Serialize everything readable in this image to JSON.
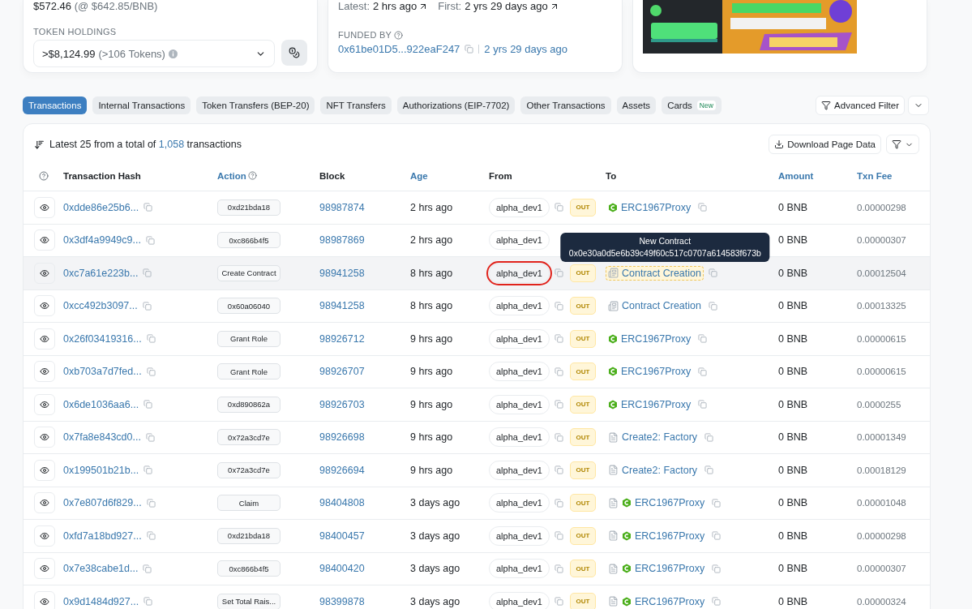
{
  "price_line": {
    "value": "$572.46",
    "rate": "(@ $642.85/BNB)"
  },
  "token_holdings": {
    "label": "TOKEN HOLDINGS",
    "value": ">$8,124.99",
    "count": "(>106 Tokens)"
  },
  "activity": {
    "latest_label": "Latest:",
    "latest": "2 hrs ago",
    "first_label": "First:",
    "first": "2 yrs 29 days ago"
  },
  "funded_by": {
    "label": "FUNDED BY",
    "address": "0x61be01D5...922eaF247",
    "age": "2 yrs 29 days ago"
  },
  "tabs": [
    {
      "label": "Transactions",
      "selected": true
    },
    {
      "label": "Internal Transactions",
      "selected": false
    },
    {
      "label": "Token Transfers (BEP-20)",
      "selected": false
    },
    {
      "label": "NFT Transfers",
      "selected": false
    },
    {
      "label": "Authorizations (EIP-7702)",
      "selected": false
    },
    {
      "label": "Other Transactions",
      "selected": false
    },
    {
      "label": "Assets",
      "selected": false
    },
    {
      "label": "Cards",
      "selected": false,
      "badge": "New"
    }
  ],
  "advanced_filter": "Advanced Filter",
  "summary": {
    "prefix": "Latest 25 from a total of",
    "count": "1,058",
    "suffix": "transactions"
  },
  "download_button": "Download Page Data",
  "table": {
    "columns": [
      {
        "label": "Transaction Hash",
        "sortable": false
      },
      {
        "label": "Action",
        "sortable": true,
        "help": true
      },
      {
        "label": "Block",
        "sortable": false
      },
      {
        "label": "Age",
        "sortable": true
      },
      {
        "label": "From",
        "sortable": false
      },
      {
        "label": "To",
        "sortable": false
      },
      {
        "label": "Amount",
        "sortable": true
      },
      {
        "label": "Txn Fee",
        "sortable": true
      }
    ],
    "rows": [
      {
        "hash": "0xdde86e25b6...",
        "action": "0xd21bda18",
        "block": "98987874",
        "age": "2 hrs ago",
        "from": "alpha_dev1",
        "direction": "OUT",
        "to": "ERC1967Proxy",
        "kind": "proxy",
        "amount": "0 BNB",
        "fee": "0.00000298",
        "highlighted": false,
        "marked": false
      },
      {
        "hash": "0x3df4a9949c9...",
        "action": "0xc866b4f5",
        "block": "98987869",
        "age": "2 hrs ago",
        "from": "alpha_dev1",
        "amount": "0 BNB",
        "fee": "0.00000307",
        "highlighted": false,
        "marked": false
      },
      {
        "hash": "0xc7a61e223b...",
        "action": "Create Contract",
        "block": "98941258",
        "age": "8 hrs ago",
        "from": "alpha_dev1",
        "direction": "OUT",
        "to": "Contract Creation",
        "kind": "creation",
        "amount": "0 BNB",
        "fee": "0.00012504",
        "highlighted": true,
        "marked": true,
        "tooltip": {
          "title": "New Contract",
          "address": "0x0e30a0d5e6b39c49f60c517c0707a614583f673b"
        }
      },
      {
        "hash": "0xcc492b3097...",
        "action": "0x60a06040",
        "block": "98941258",
        "age": "8 hrs ago",
        "from": "alpha_dev1",
        "direction": "OUT",
        "to": "Contract Creation",
        "kind": "creation",
        "amount": "0 BNB",
        "fee": "0.00013325",
        "highlighted": false,
        "marked": false
      },
      {
        "hash": "0x26f03419316...",
        "action": "Grant Role",
        "block": "98926712",
        "age": "9 hrs ago",
        "from": "alpha_dev1",
        "direction": "OUT",
        "to": "ERC1967Proxy",
        "kind": "proxy",
        "amount": "0 BNB",
        "fee": "0.00000615",
        "highlighted": false,
        "marked": false
      },
      {
        "hash": "0xb703a7d7fed...",
        "action": "Grant Role",
        "block": "98926707",
        "age": "9 hrs ago",
        "from": "alpha_dev1",
        "direction": "OUT",
        "to": "ERC1967Proxy",
        "kind": "proxy",
        "amount": "0 BNB",
        "fee": "0.00000615",
        "highlighted": false,
        "marked": false
      },
      {
        "hash": "0x6de1036aa6...",
        "action": "0xd890862a",
        "block": "98926703",
        "age": "9 hrs ago",
        "from": "alpha_dev1",
        "direction": "OUT",
        "to": "ERC1967Proxy",
        "kind": "proxy",
        "amount": "0 BNB",
        "fee": "0.0000255",
        "highlighted": false,
        "marked": false
      },
      {
        "hash": "0x7fa8e843cd0...",
        "action": "0x72a3cd7e",
        "block": "98926698",
        "age": "9 hrs ago",
        "from": "alpha_dev1",
        "direction": "OUT",
        "to": "Create2: Factory",
        "kind": "factory",
        "amount": "0 BNB",
        "fee": "0.00001349",
        "highlighted": false,
        "marked": false
      },
      {
        "hash": "0x199501b21b...",
        "action": "0x72a3cd7e",
        "block": "98926694",
        "age": "9 hrs ago",
        "from": "alpha_dev1",
        "direction": "OUT",
        "to": "Create2: Factory",
        "kind": "factory",
        "amount": "0 BNB",
        "fee": "0.00018129",
        "highlighted": false,
        "marked": false
      },
      {
        "hash": "0x7e807d6f829...",
        "action": "Claim",
        "block": "98404808",
        "age": "3 days ago",
        "from": "alpha_dev1",
        "direction": "OUT",
        "to": "ERC1967Proxy",
        "kind": "verified_proxy",
        "amount": "0 BNB",
        "fee": "0.00001048",
        "highlighted": false,
        "marked": false
      },
      {
        "hash": "0xfd7a18bd927...",
        "action": "0xd21bda18",
        "block": "98400457",
        "age": "3 days ago",
        "from": "alpha_dev1",
        "direction": "OUT",
        "to": "ERC1967Proxy",
        "kind": "verified_proxy",
        "amount": "0 BNB",
        "fee": "0.00000298",
        "highlighted": false,
        "marked": false
      },
      {
        "hash": "0x7e38cabe1d...",
        "action": "0xc866b4f5",
        "block": "98400420",
        "age": "3 days ago",
        "from": "alpha_dev1",
        "direction": "OUT",
        "to": "ERC1967Proxy",
        "kind": "verified_proxy",
        "amount": "0 BNB",
        "fee": "0.00000307",
        "highlighted": false,
        "marked": false
      },
      {
        "hash": "0x9d1484d927...",
        "action": "Set Total Rais...",
        "block": "98399878",
        "age": "3 days ago",
        "from": "alpha_dev1",
        "direction": "OUT",
        "to": "ERC1967Proxy",
        "kind": "verified_proxy",
        "amount": "0 BNB",
        "fee": "0.00000324",
        "highlighted": false,
        "marked": false
      }
    ]
  }
}
